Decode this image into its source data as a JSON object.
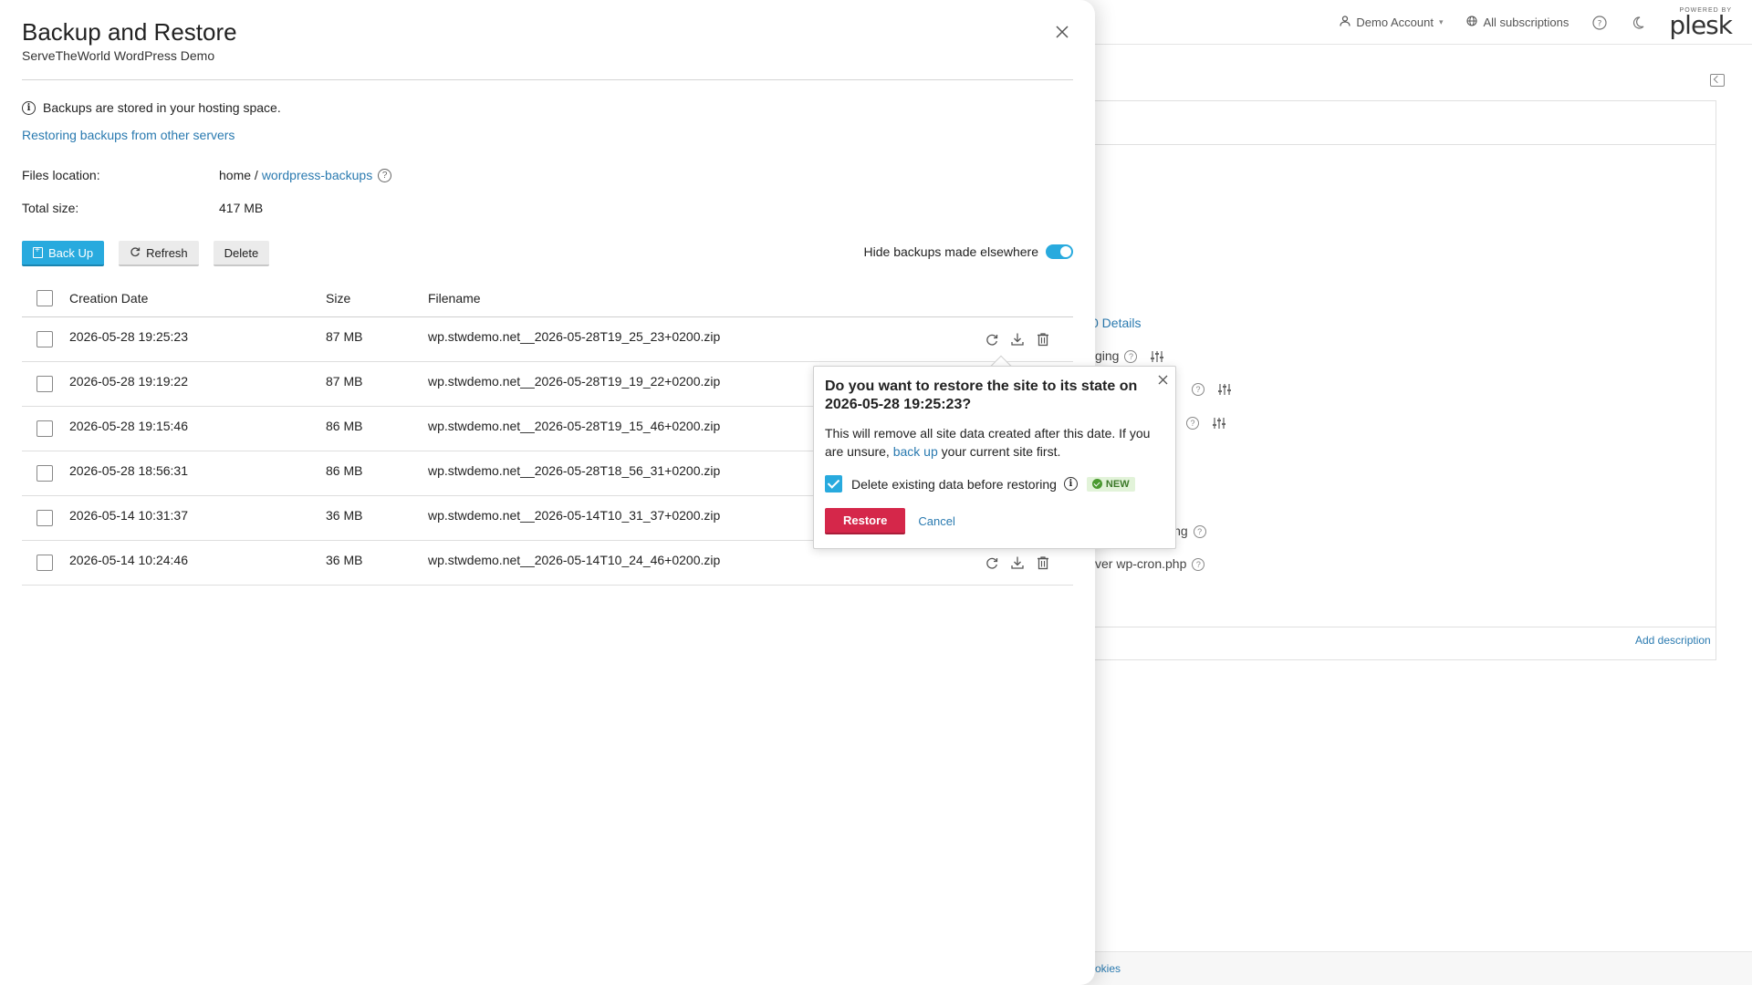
{
  "background": {
    "header": {
      "account": "Demo Account",
      "subscriptions": "All subscriptions",
      "powered_by": "POWERED BY",
      "logo": "plesk"
    },
    "fragments": {
      "details": "0 Details",
      "item1": "ging",
      "item2": "ing",
      "item3": "ver wp-cron.php",
      "add_description": "Add description",
      "footer_cookies": "okies"
    }
  },
  "drawer": {
    "title": "Backup and Restore",
    "subtitle": "ServeTheWorld WordPress Demo",
    "info_text": "Backups are stored in your hosting space.",
    "restore_other_link": "Restoring backups from other servers",
    "files_location_label": "Files location:",
    "files_location_prefix": "home /",
    "files_location_link": "wordpress-backups",
    "total_size_label": "Total size:",
    "total_size_value": "417 MB",
    "toolbar": {
      "backup_label": "Back Up",
      "refresh_label": "Refresh",
      "delete_label": "Delete"
    },
    "hide_toggle_label": "Hide backups made elsewhere",
    "hide_toggle_on": true,
    "table": {
      "columns": [
        "Creation Date",
        "Size",
        "Filename"
      ],
      "rows": [
        {
          "date": "2026-05-28 19:25:23",
          "size": "87 MB",
          "filename": "wp.stwdemo.net__2026-05-28T19_25_23+0200.zip"
        },
        {
          "date": "2026-05-28 19:19:22",
          "size": "87 MB",
          "filename": "wp.stwdemo.net__2026-05-28T19_19_22+0200.zip"
        },
        {
          "date": "2026-05-28 19:15:46",
          "size": "86 MB",
          "filename": "wp.stwdemo.net__2026-05-28T19_15_46+0200.zip"
        },
        {
          "date": "2026-05-28 18:56:31",
          "size": "86 MB",
          "filename": "wp.stwdemo.net__2026-05-28T18_56_31+0200.zip"
        },
        {
          "date": "2026-05-14 10:31:37",
          "size": "36 MB",
          "filename": "wp.stwdemo.net__2026-05-14T10_31_37+0200.zip"
        },
        {
          "date": "2026-05-14 10:24:46",
          "size": "36 MB",
          "filename": "wp.stwdemo.net__2026-05-14T10_24_46+0200.zip"
        }
      ]
    }
  },
  "popover": {
    "title": "Do you want to restore the site to its state on 2026-05-28 19:25:23?",
    "body_part1": "This will remove all site data created after this date. If you are unsure,",
    "body_link": "back up",
    "body_part2": "your current site first.",
    "checkbox_label": "Delete existing data before restoring",
    "checkbox_checked": true,
    "badge": "NEW",
    "restore_label": "Restore",
    "cancel_label": "Cancel"
  },
  "colors": {
    "accent": "#28aade",
    "link": "#2a7ab0",
    "danger": "#d5274a",
    "badge_bg": "#e2f3d9"
  }
}
